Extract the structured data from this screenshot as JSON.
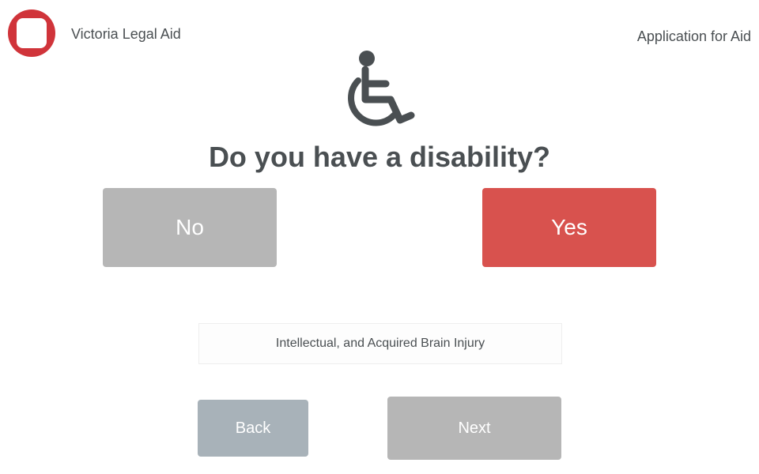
{
  "header": {
    "org_name": "Victoria Legal Aid",
    "app_title": "Application for Aid",
    "logo_color": "#d0343a"
  },
  "hero": {
    "icon": "wheelchair-icon",
    "icon_color": "#4a4f52"
  },
  "question": {
    "text": "Do you have a disability?"
  },
  "choices": {
    "no_label": "No",
    "yes_label": "Yes",
    "no_color": "#b6b6b6",
    "yes_color": "#d8524e"
  },
  "info": {
    "text": "Intellectual, and Acquired Brain Injury"
  },
  "navigation": {
    "back_label": "Back",
    "next_label": "Next",
    "back_color": "#a8b2b9",
    "next_color": "#b6b6b6"
  }
}
